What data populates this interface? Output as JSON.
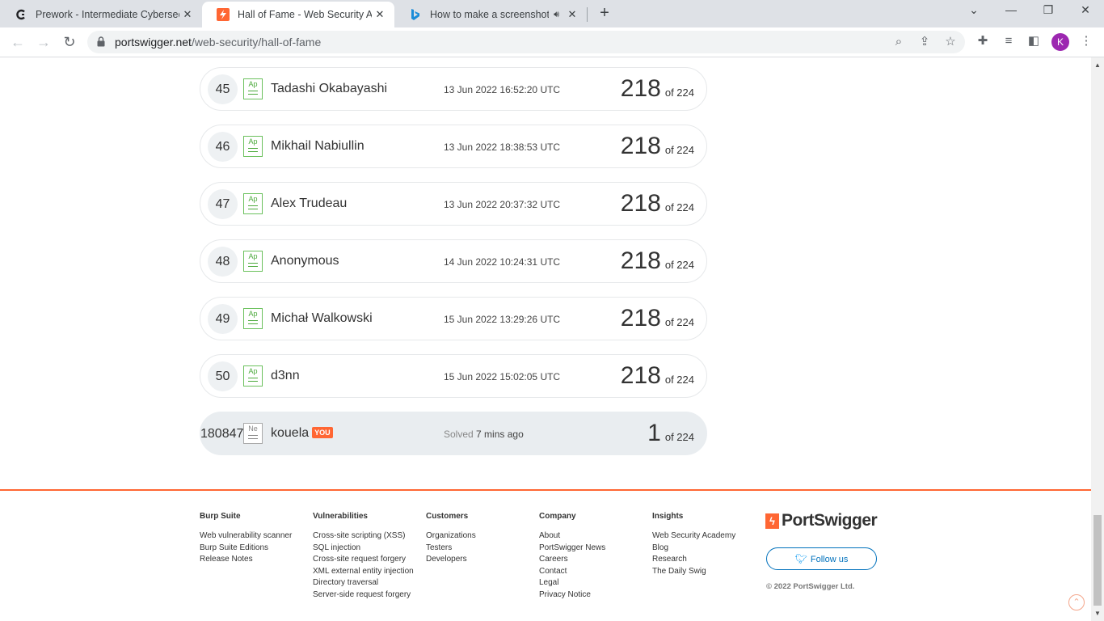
{
  "browser": {
    "tabs": [
      {
        "title": "Prework - Intermediate Cybersec",
        "favicon": "c-logo-icon",
        "active": false
      },
      {
        "title": "Hall of Fame - Web Security Acad",
        "favicon": "portswigger-icon",
        "active": true
      },
      {
        "title": "How to make a screenshot in",
        "favicon": "bing-icon",
        "active": false,
        "audio": true
      }
    ],
    "new_tab": "+",
    "url_host": "portswigger.net",
    "url_path": "/web-security/hall-of-fame",
    "profile_initial": "K"
  },
  "leaderboard": {
    "rows": [
      {
        "rank": "45",
        "badge": "Ap",
        "name": "Tadashi Okabayashi",
        "date": "13 Jun 2022 16:52:20 UTC",
        "score": "218",
        "total": "of 224"
      },
      {
        "rank": "46",
        "badge": "Ap",
        "name": "Mikhail Nabiullin",
        "date": "13 Jun 2022 18:38:53 UTC",
        "score": "218",
        "total": "of 224"
      },
      {
        "rank": "47",
        "badge": "Ap",
        "name": "Alex Trudeau",
        "date": "13 Jun 2022 20:37:32 UTC",
        "score": "218",
        "total": "of 224"
      },
      {
        "rank": "48",
        "badge": "Ap",
        "name": "Anonymous",
        "date": "14 Jun 2022 10:24:31 UTC",
        "score": "218",
        "total": "of 224"
      },
      {
        "rank": "49",
        "badge": "Ap",
        "name": "Michał Walkowski",
        "date": "15 Jun 2022 13:29:26 UTC",
        "score": "218",
        "total": "of 224"
      },
      {
        "rank": "50",
        "badge": "Ap",
        "name": "d3nn",
        "date": "15 Jun 2022 15:02:05 UTC",
        "score": "218",
        "total": "of 224"
      }
    ],
    "you": {
      "rank": "180847",
      "badge": "Ne",
      "name": "kouela",
      "tag": "YOU",
      "solved_label": "Solved",
      "solved_when": "7 mins ago",
      "score": "1",
      "total": "of 224"
    }
  },
  "footer": {
    "columns": [
      {
        "heading": "Burp Suite",
        "links": [
          "Web vulnerability scanner",
          "Burp Suite Editions",
          "Release Notes"
        ]
      },
      {
        "heading": "Vulnerabilities",
        "links": [
          "Cross-site scripting (XSS)",
          "SQL injection",
          "Cross-site request forgery",
          "XML external entity injection",
          "Directory traversal",
          "Server-side request forgery"
        ]
      },
      {
        "heading": "Customers",
        "links": [
          "Organizations",
          "Testers",
          "Developers"
        ]
      },
      {
        "heading": "Company",
        "links": [
          "About",
          "PortSwigger News",
          "Careers",
          "Contact",
          "Legal",
          "Privacy Notice"
        ]
      },
      {
        "heading": "Insights",
        "links": [
          "Web Security Academy",
          "Blog",
          "Research",
          "The Daily Swig"
        ]
      }
    ],
    "brand": "PortSwigger",
    "follow_label": "Follow us",
    "copyright": "© 2022 PortSwigger Ltd.",
    "accent_color": "#ff6633"
  }
}
